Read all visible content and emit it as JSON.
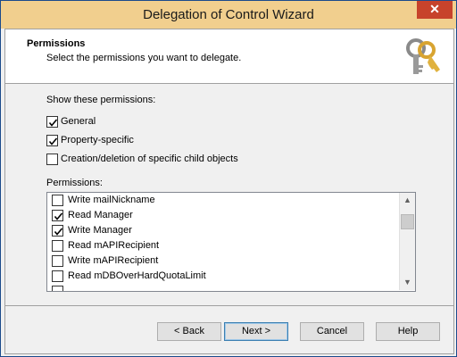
{
  "window": {
    "title": "Delegation of Control Wizard",
    "close_glyph": "✕"
  },
  "header": {
    "title": "Permissions",
    "subtitle": "Select the permissions you want to delegate.",
    "icon": "keys-icon"
  },
  "show": {
    "label": "Show these permissions:",
    "options": [
      {
        "label": "General",
        "checked": true
      },
      {
        "label": "Property-specific",
        "checked": true
      },
      {
        "label": "Creation/deletion of specific child objects",
        "checked": false
      }
    ]
  },
  "permissions": {
    "label": "Permissions:",
    "items": [
      {
        "label": "Write mailNickname",
        "checked": false
      },
      {
        "label": "Read Manager",
        "checked": true
      },
      {
        "label": "Write Manager",
        "checked": true
      },
      {
        "label": "Read mAPIRecipient",
        "checked": false
      },
      {
        "label": "Write mAPIRecipient",
        "checked": false
      },
      {
        "label": "Read mDBOverHardQuotaLimit",
        "checked": false
      }
    ],
    "scroll_up_glyph": "▲",
    "scroll_down_glyph": "▼"
  },
  "buttons": {
    "back": "< Back",
    "next": "Next >",
    "cancel": "Cancel",
    "help": "Help"
  },
  "colors": {
    "titlebar": "#f1cf8e",
    "close": "#c7432b",
    "default_button_border": "#3c7fb1"
  }
}
